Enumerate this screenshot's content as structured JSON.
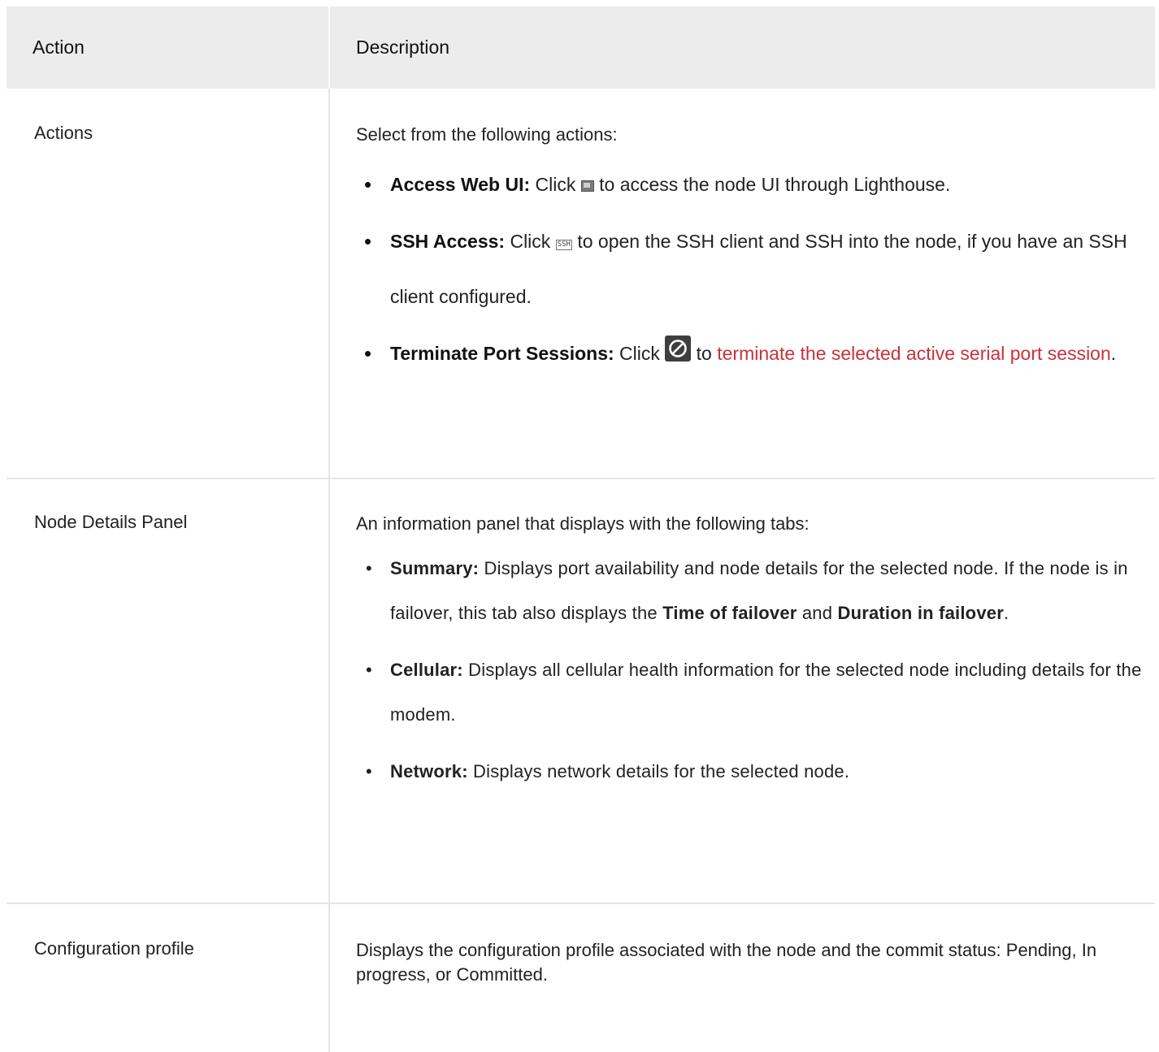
{
  "table": {
    "header": {
      "action": "Action",
      "description": "Description"
    },
    "rows": [
      {
        "action": "Actions",
        "intro": "Select from the following actions:",
        "items": [
          {
            "term": "Access Web UI:",
            "before_icon": " Click ",
            "icon": "web-ui-icon",
            "after_icon": " to access the node UI through Lighthouse."
          },
          {
            "term": "SSH Access:",
            "before_icon": " Click ",
            "icon": "ssh-icon",
            "icon_text": "SSH",
            "after_icon": " to open the SSH client and SSH into the node, if you have an SSH client configured."
          },
          {
            "term": "Terminate Port Sessions:",
            "before_icon": " Click ",
            "icon": "terminate-icon",
            "after_icon": " to ",
            "link": "terminate the selected active serial port session",
            "after_link": "."
          }
        ]
      },
      {
        "action": "Node Details Panel",
        "intro": "An information panel that displays with the following tabs:",
        "items": [
          {
            "term": "Summary:",
            "text1": " Displays port availability and node details for the selected node. If the node is in failover, this tab also displays the ",
            "bold1": "Time of failover",
            "text2": " and ",
            "bold2": "Duration in failover",
            "text3": "."
          },
          {
            "term": "Cellular:",
            "text1": " Displays all cellular health information for the selected node including details for the modem."
          },
          {
            "term": "Network:",
            "text1": " Displays network details for the selected node."
          }
        ]
      },
      {
        "action": "Configuration profile",
        "description": "Displays the configuration profile associated with the node and the commit status: Pending, In progress, or Committed."
      }
    ]
  },
  "colors": {
    "header_bg": "#ececec",
    "link": "#c8323a",
    "border": "#e5e5e5",
    "text": "#222222"
  }
}
